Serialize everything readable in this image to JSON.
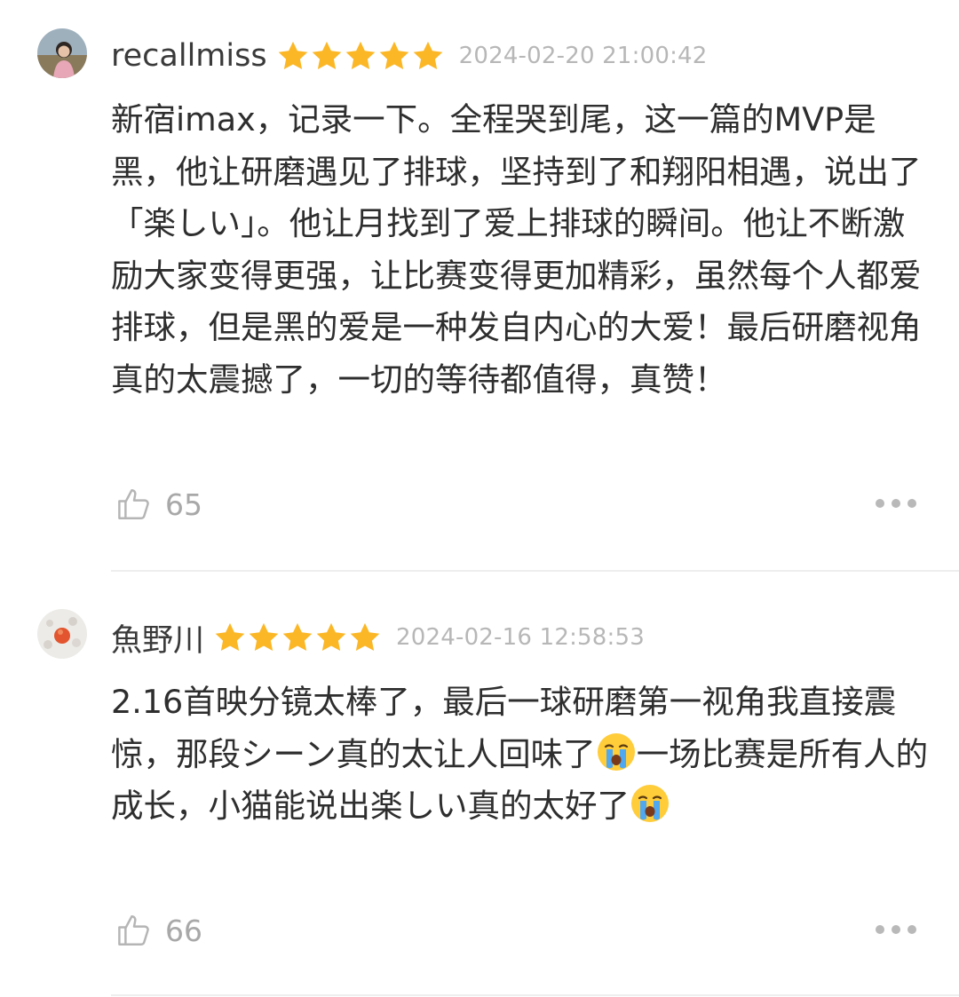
{
  "reviews": [
    {
      "username": "recallmiss",
      "rating": 5,
      "date": "2024-02-20 21:00:42",
      "text": "新宿imax，记录一下。全程哭到尾，这一篇的MVP是黑，他让研磨遇见了排球，坚持到了和翔阳相遇，说出了「楽しい」。他让月找到了爱上排球的瞬间。他让不断激励大家变得更强，让比赛变得更加精彩，虽然每个人都爱排球，但是黑的爱是一种发自内心的大爱！最后研磨视角真的太震撼了，一切的等待都值得，真赞！",
      "likes": "65"
    },
    {
      "username": "魚野川",
      "rating": 5,
      "date": "2024-02-16 12:58:53",
      "text_part1": "2.16首映分镜太棒了，最后一球研磨第一视角我直接震惊，那段シーン真的太让人回味了",
      "text_part2": "一场比赛是所有人的成长，小猫能说出楽しい真的太好了",
      "emoji": "loudly-crying-face",
      "likes": "66"
    }
  ],
  "colors": {
    "star": "#fbb726",
    "meta_text": "#b7b7b7",
    "body_text": "#2e2e2e",
    "divider": "#eeeeee"
  },
  "icons": [
    "star-icon",
    "thumbs-up-icon",
    "more-icon",
    "loudly-crying-face-emoji"
  ]
}
